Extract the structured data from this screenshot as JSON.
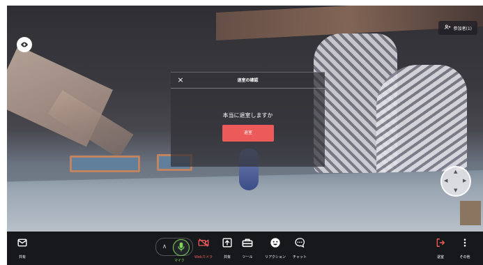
{
  "scene": {
    "participants_label": "参加者(1)",
    "icons": {
      "eye": "eye-icon",
      "participants": "people-icon",
      "move_pad": "direction-pad-icon"
    }
  },
  "dialog": {
    "title": "退室の確認",
    "message": "本当に退室しますか",
    "confirm_label": "退室",
    "close_glyph": "×"
  },
  "toolbar": {
    "share_left_label": "共有",
    "mic_label": "マイク",
    "camera_label": "Webカメラ",
    "share_label": "共有",
    "tools_label": "ツール",
    "reaction_label": "リアクション",
    "chat_label": "チャット",
    "leave_label": "退室",
    "more_label": "その他"
  },
  "colors": {
    "accent_red": "#ec5a5a",
    "mic_green": "#7fd45a",
    "toolbar_bg": "#16181c"
  }
}
